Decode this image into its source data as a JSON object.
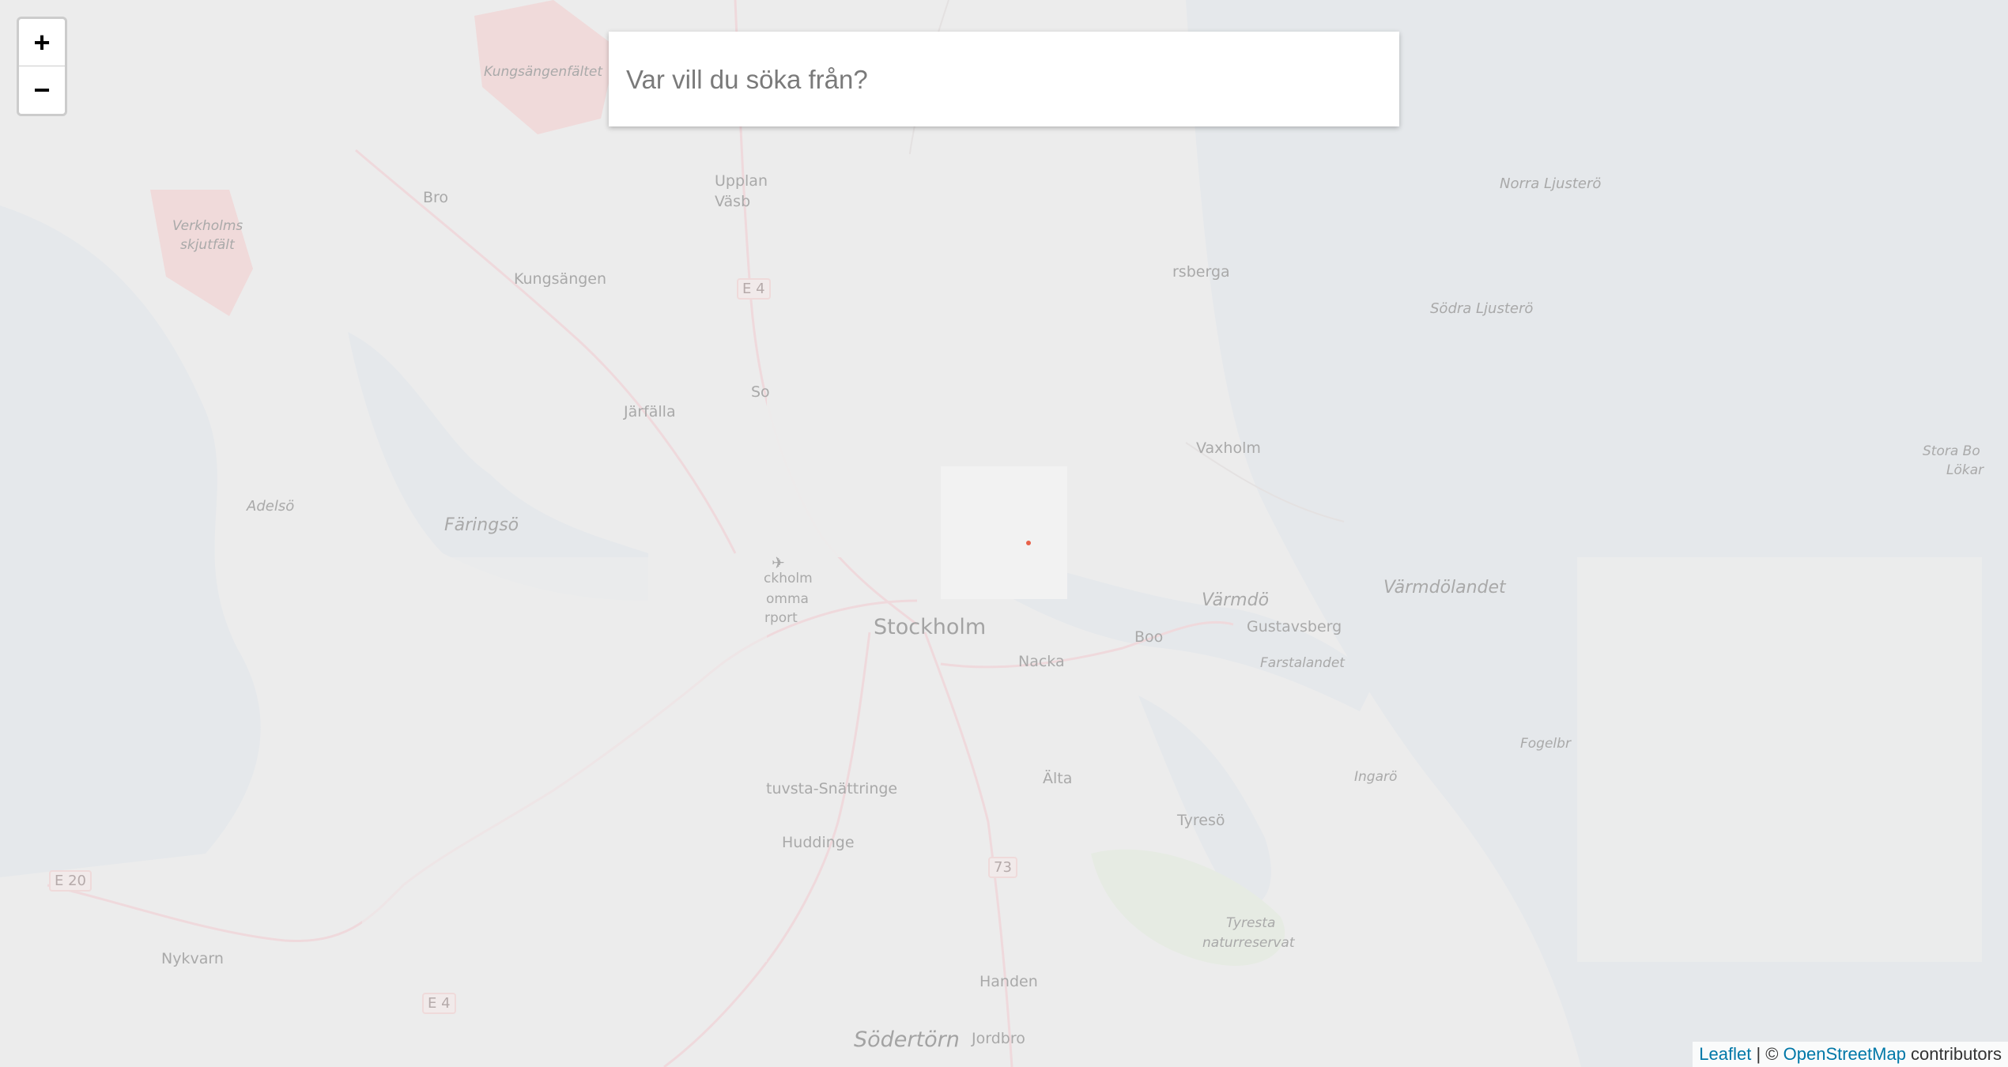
{
  "search": {
    "placeholder": "Var vill du söka från?"
  },
  "zoom": {
    "in_label": "+",
    "out_label": "−"
  },
  "attribution": {
    "leaflet": "Leaflet",
    "separator": " | © ",
    "osm": "OpenStreetMap",
    "suffix": " contributors"
  },
  "map": {
    "places": {
      "stockholm": "Stockholm",
      "nacka": "Nacka",
      "boo": "Boo",
      "varmdo": "Värmdö",
      "gustavsberg": "Gustavsberg",
      "varmdolandet": "Värmdölandet",
      "farstalandet": "Farstalandet",
      "fogelbr": "Fogelbr",
      "ingaro": "Ingarö",
      "tyreso": "Tyresö",
      "tyreso_nature_1": "Tyresta",
      "tyreso_nature_2": "naturreservat",
      "alta": "Älta",
      "huddinge": "Huddinge",
      "stuvsta": "tuvsta-Snättringe",
      "handen": "Handen",
      "jordbro": "Jordbro",
      "sodertorn": "Södertörn",
      "nykvarn": "Nykvarn",
      "jarfalla": "Järfälla",
      "kungsangen": "Kungsängen",
      "kungsangenfaltet": "Kungsängenfältet",
      "bro": "Bro",
      "faringso": "Färingsö",
      "adelso": "Adelsö",
      "verkholms_1": "Verkholms",
      "verkholms_2": "skjutfält",
      "upplands_1": "Upplan",
      "upplands_2": "Väsb",
      "so": "So",
      "osberga": "rsberga",
      "vaxholm": "Vaxholm",
      "norra_ljustero": "Norra Ljusterö",
      "sodra_ljustero": "Södra Ljusterö",
      "stora_bo_1": "Stora Bo",
      "stora_bo_2": "Lökar",
      "airport_1": "ckholm",
      "airport_2": "omma",
      "airport_3": "rport"
    },
    "shields": {
      "e4_north": "E 4",
      "e20": "E 20",
      "e4_south": "E 4",
      "r73": "73"
    }
  }
}
